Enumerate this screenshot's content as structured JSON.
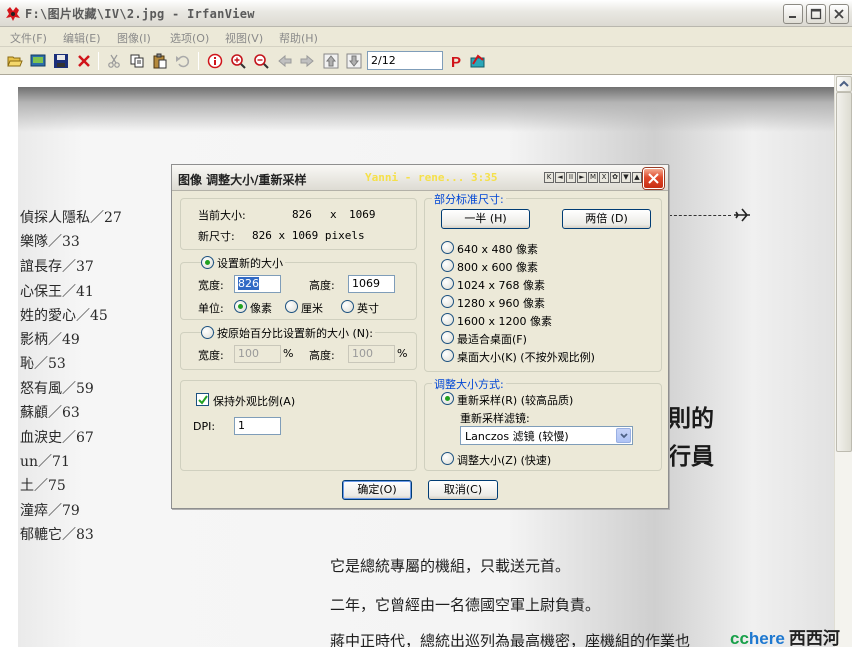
{
  "window": {
    "title": "F:\\图片收藏\\IV\\2.jpg - IrfanView"
  },
  "menu": [
    "文件(F)",
    "编辑(E)",
    "图像(I)",
    "选项(O)",
    "视图(V)",
    "帮助(H)"
  ],
  "toolbar": {
    "page_value": "2/12"
  },
  "icons": {
    "app": "irfanview-cat-icon",
    "open": "folder-open-icon",
    "slideshow": "slideshow-icon",
    "save": "floppy-disk-icon",
    "delete": "red-x-icon",
    "cut": "scissors-icon",
    "copy": "copy-icon",
    "paste": "paste-icon",
    "undo": "undo-icon",
    "info": "info-icon",
    "zoom_in": "zoom-in-icon",
    "zoom_out": "zoom-out-icon",
    "prev": "arrow-left-icon",
    "next": "arrow-right-icon",
    "first": "arrow-up-file-icon",
    "last": "arrow-down-file-icon",
    "print": "p-print-icon",
    "paint": "paint-icon"
  },
  "photo": {
    "left_lines": [
      "偵探人隱私／27",
      "樂隊／33",
      "誼長存／37",
      "心保王／41",
      "姓的愛心／45",
      "影柄／49",
      "恥／53",
      "怒有風／59",
      "蘇顧／63",
      "血淚史／67",
      "un／71",
      "土／75",
      "潼瘁／79",
      "郁轆它／83"
    ],
    "right_big": [
      "則的",
      "行員"
    ],
    "bottom_lines": [
      "它是總統專屬的機組，只載送元首。",
      "二年，它曾經由一名德國空軍上尉負責。",
      "蔣中正時代，總統出巡列為最高機密，座機組的作業也"
    ]
  },
  "watermark": {
    "cc": "cc",
    "here": "here",
    "cn": "西西河"
  },
  "dialog": {
    "title": "图像 调整大小/重新采样",
    "media_text": "Yanni  - rene...   3:35",
    "media_buttons": [
      "K",
      "◄",
      "II",
      "►",
      "M",
      "X",
      "✿",
      "▼",
      "▲"
    ],
    "current": {
      "current_label": "当前大小:",
      "current_w": "826",
      "x": "x",
      "current_h": "1069",
      "new_label": "新尺寸:",
      "new_value": "826  x  1069  pixels"
    },
    "set_new": {
      "radio_label": "设置新的大小",
      "width_label": "宽度:",
      "width_value": "826",
      "height_label": "高度:",
      "height_value": "1069",
      "unit_label": "单位:",
      "units": [
        "像素",
        "厘米",
        "英寸"
      ],
      "selected_unit": "像素"
    },
    "percent": {
      "radio_label": "按原始百分比设置新的大小",
      "radio_key": "(N):",
      "width_label": "宽度:",
      "width_value": "100",
      "pct": "%",
      "height_label": "高度:",
      "height_value": "100",
      "pct2": "%"
    },
    "keep_ratio": {
      "label": "保持外观比例",
      "key": "(A)",
      "checked": true
    },
    "dpi": {
      "label": "DPI:",
      "value": "1"
    },
    "standard": {
      "legend": "部分标准尺寸:",
      "half_button": "一半",
      "half_key": "(H)",
      "double_button": "两倍",
      "double_key": "(D)",
      "options": [
        "640 x 480 像素",
        "800 x 600 像素",
        "1024 x 768 像素",
        "1280 x 960 像素",
        "1600 x 1200 像素",
        "最适合桌面",
        "桌面大小"
      ],
      "option_keys": [
        "",
        "",
        "",
        "",
        "",
        "(F)",
        "(K)"
      ],
      "desktop_note": "(不按外观比例)"
    },
    "method": {
      "legend": "调整大小方式:",
      "resample_label": "重新采样",
      "resample_key": "(R)",
      "resample_note": "(较高品质)",
      "filter_label": "重新采样滤镜:",
      "filter_value": "Lanczos 滤镜 (较慢)",
      "resize_label": "调整大小",
      "resize_key": "(Z)",
      "resize_note": "(快速)",
      "selected": "resample"
    },
    "ok_label": "确定",
    "ok_key": "(O)",
    "cancel_label": "取消",
    "cancel_key": "(C)"
  }
}
